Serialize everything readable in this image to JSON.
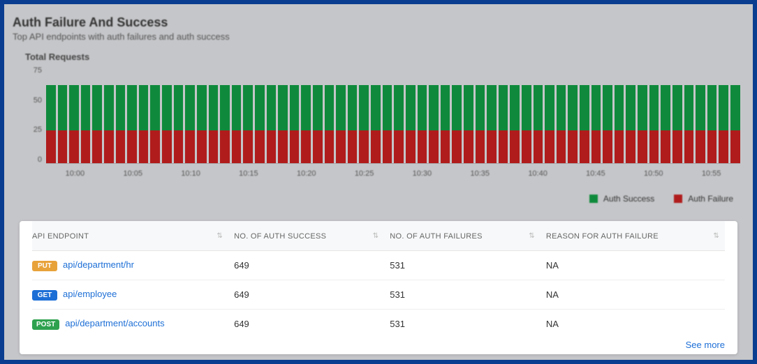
{
  "header": {
    "title": "Auth Failure And Success",
    "subtitle": "Top API endpoints with auth failures and auth success"
  },
  "chart_data": {
    "type": "bar",
    "title": "Total Requests",
    "ylabel": "",
    "xlabel": "",
    "ylim": [
      0,
      75
    ],
    "y_ticks": [
      75,
      50,
      25,
      0
    ],
    "x_ticks": [
      "10:00",
      "10:05",
      "10:10",
      "10:15",
      "10:20",
      "10:25",
      "10:30",
      "10:35",
      "10:40",
      "10:45",
      "10:50",
      "10:55"
    ],
    "bar_count": 60,
    "series": [
      {
        "name": "Auth Success",
        "color": "#0f8a3c",
        "value_each": 35
      },
      {
        "name": "Auth Failure",
        "color": "#b01c1c",
        "value_each": 25
      }
    ],
    "legend_position": "bottom-right"
  },
  "table": {
    "columns": [
      "API ENDPOINT",
      "NO. OF AUTH SUCCESS",
      "NO. OF AUTH FAILURES",
      "REASON FOR AUTH FAILURE"
    ],
    "rows": [
      {
        "method": "PUT",
        "endpoint": "api/department/hr",
        "success": "649",
        "failures": "531",
        "reason": "NA"
      },
      {
        "method": "GET",
        "endpoint": "api/employee",
        "success": "649",
        "failures": "531",
        "reason": "NA"
      },
      {
        "method": "POST",
        "endpoint": "api/department/accounts",
        "success": "649",
        "failures": "531",
        "reason": "NA"
      }
    ],
    "see_more": "See more"
  }
}
